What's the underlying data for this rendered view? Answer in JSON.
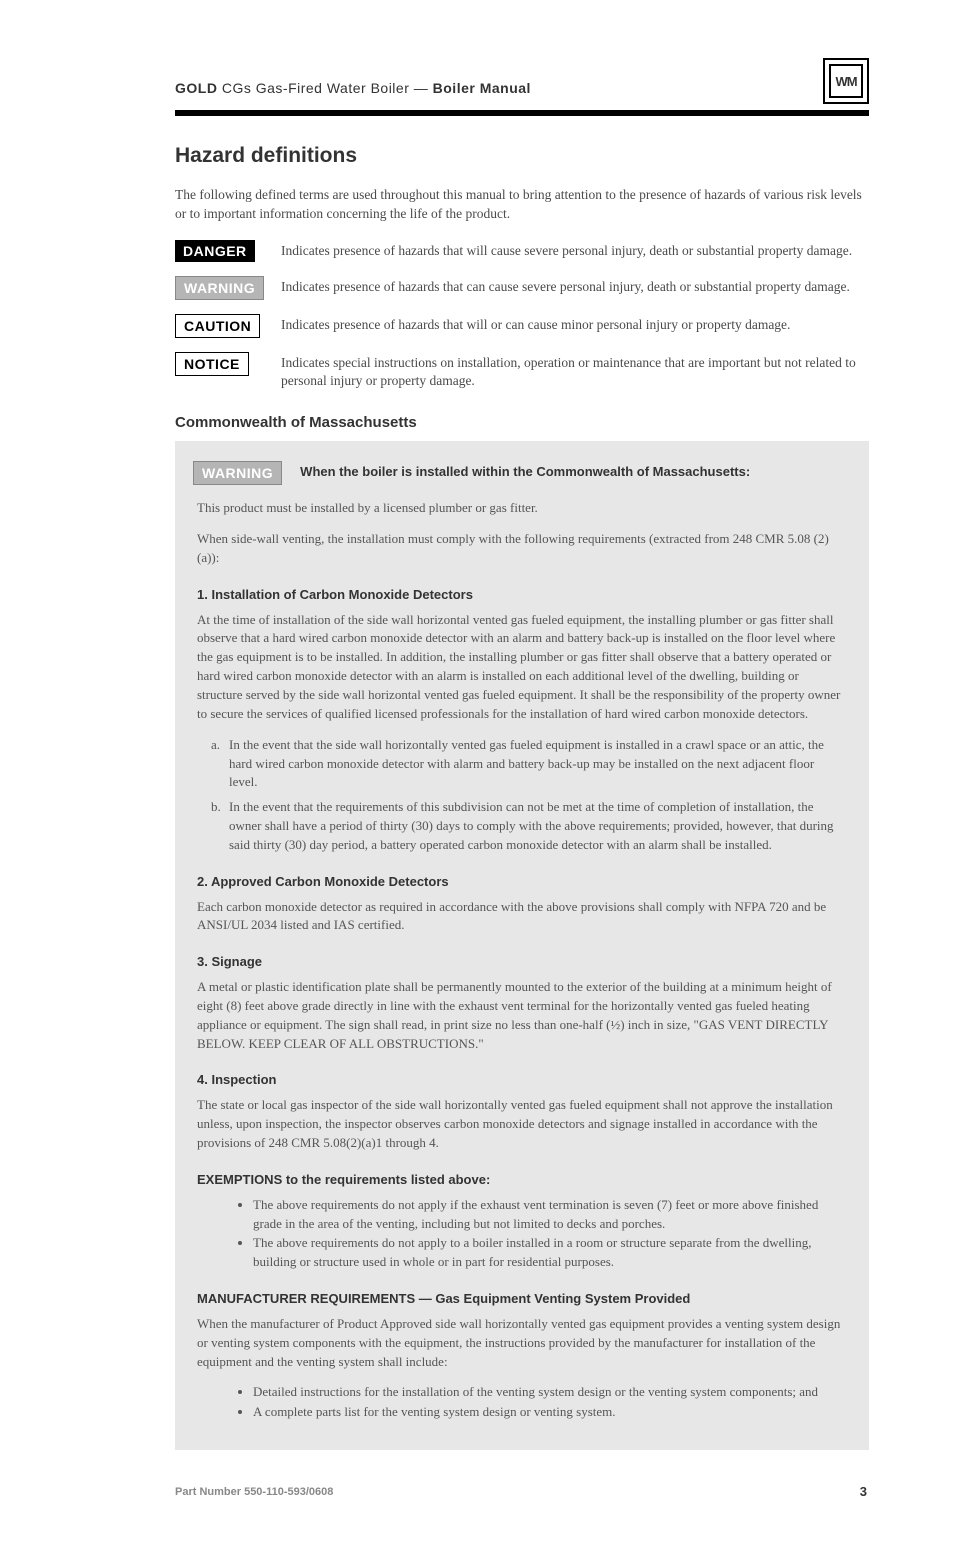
{
  "header": {
    "brand": "GOLD",
    "product": "CGs Gas-Fired Water Boiler — ",
    "doc_title": "Boiler Manual"
  },
  "logo_text": "WM",
  "section_title": "Hazard definitions",
  "intro": "The following defined terms are used throughout this manual to bring attention to the presence of hazards of various risk levels or to important information concerning the life of the product.",
  "hazards": [
    {
      "label": "DANGER",
      "class": "label-danger",
      "text": "Indicates presence of hazards that will cause severe personal injury, death or substantial property damage."
    },
    {
      "label": "WARNING",
      "class": "label-warning",
      "text": "Indicates presence of hazards that can cause severe personal injury, death or substantial property damage."
    },
    {
      "label": "CAUTION",
      "class": "label-caution",
      "text": "Indicates presence of hazards that will or can cause minor personal injury or property damage."
    },
    {
      "label": "NOTICE",
      "class": "label-notice",
      "text": "Indicates special instructions on installation, operation or maintenance that are important but not related to personal injury or property damage."
    }
  ],
  "commonwealth_title": "Commonwealth of Massachusetts",
  "grey_panel": {
    "warning_label": "WARNING",
    "heading": "When the boiler is installed within the Commonwealth of Massachusetts:",
    "p1": "This product must be installed by a licensed plumber or gas fitter.",
    "p2": "When side-wall venting, the installation must comply with the following requirements (extracted from 248 CMR 5.08 (2)(a)):",
    "sec1_title": "1. Installation of Carbon Monoxide Detectors",
    "sec1_lead": "At the time of installation of the side wall horizontal vented gas fueled equipment, the installing plumber or gas fitter shall observe that a hard wired carbon monoxide detector with an alarm and battery back-up is installed on the floor level where the gas equipment is to be installed. In addition, the installing plumber or gas fitter shall observe that a battery operated or hard wired carbon monoxide detector with an alarm is installed on each additional level of the dwelling, building or structure served by the side wall horizontal vented gas fueled equipment. It shall be the responsibility of the property owner to secure the services of qualified licensed professionals for the installation of hard wired carbon monoxide detectors.",
    "sec1_a_lead": "In the event that the side wall horizontally vented gas fueled equipment is installed in a crawl space or an attic, the hard wired carbon monoxide detector with alarm and battery back-up may be installed on the next adjacent floor level.",
    "sec1_b_lead": "In the event that the requirements of this subdivision can not be met at the time of completion of installation, the owner shall have a period of thirty (30) days to comply with the above requirements; provided, however, that during said thirty (30) day period, a battery operated carbon monoxide detector with an alarm shall be installed.",
    "sec2_title": "2. Approved Carbon Monoxide Detectors",
    "sec2_body": "Each carbon monoxide detector as required in accordance with the above provisions shall comply with NFPA 720 and be ANSI/UL 2034 listed and IAS certified.",
    "sec3_title": "3. Signage",
    "sec3_body": "A metal or plastic identification plate shall be permanently mounted to the exterior of the building at a minimum height of eight (8) feet above grade directly in line with the exhaust vent terminal for the horizontally vented gas fueled heating appliance or equipment. The sign shall read, in print size no less than one-half (½) inch in size, \"GAS VENT DIRECTLY BELOW. KEEP CLEAR OF ALL OBSTRUCTIONS.\"",
    "sec4_title": "4. Inspection",
    "sec4_body": "The state or local gas inspector of the side wall horizontally vented gas fueled equipment shall not approve the installation unless, upon inspection, the inspector observes carbon monoxide detectors and signage installed in accordance with the provisions of 248 CMR 5.08(2)(a)1 through 4.",
    "exempt_title": "EXEMPTIONS to the requirements listed above:",
    "exempt_items": [
      "The above requirements do not apply if the exhaust vent termination is seven (7) feet or more above finished grade in the area of the venting, including but not limited to decks and porches.",
      "The above requirements do not apply to a boiler installed in a room or structure separate from the dwelling, building or structure used in whole or in part for residential purposes."
    ],
    "manuf_title": "MANUFACTURER REQUIREMENTS — Gas Equipment Venting System Provided",
    "manuf_body": "When the manufacturer of Product Approved side wall horizontally vented gas equipment provides a venting system design or venting system components with the equipment, the instructions provided by the manufacturer for installation of the equipment and the venting system shall include:",
    "manuf_list": [
      "Detailed instructions for the installation of the venting system design or the venting system components; and",
      "A complete parts list for the venting system design or venting system."
    ]
  },
  "part_number": "Part Number 550-110-593/0608",
  "page_number": "3"
}
